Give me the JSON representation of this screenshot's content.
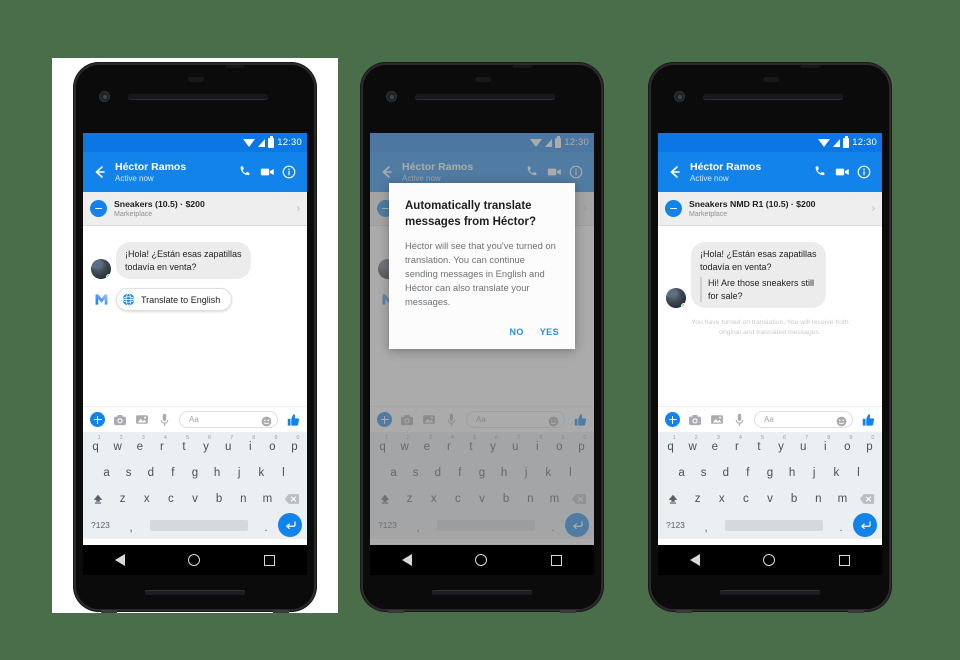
{
  "background_color": "#4a6d4a",
  "accent_color": "#1183ea",
  "status_bar": {
    "time": "12:30",
    "icons": [
      "wifi-icon",
      "signal-icon",
      "battery-icon"
    ]
  },
  "chat_header": {
    "back_icon": "arrow-left-icon",
    "contact_name": "Héctor Ramos",
    "presence": "Active now",
    "call_icon": "phone-icon",
    "video_icon": "video-camera-icon",
    "info_icon": "info-circle-icon"
  },
  "marketplace_row": {
    "icon": "marketplace-icon",
    "title_phone1": "Sneakers (10.5) · $200",
    "title_phone2": "Sneakers NMD R1 (10.5) · $200",
    "title_phone3": "Sneakers NMD R1 (10.5) · $200",
    "subtitle": "Marketplace",
    "chevron": "chevron-right-icon"
  },
  "conversation": {
    "incoming_original_line1": "¡Hola! ¿Están esas zapatillas",
    "incoming_original_line2": "todavía en venta?",
    "incoming_translated_line1": "Hi! Are those sneakers still",
    "incoming_translated_line2": "for sale?",
    "avatar": "contact-avatar",
    "online_indicator": "online-status-dot"
  },
  "translate_prompt": {
    "messenger_logo": "messenger-m-logo",
    "globe_icon": "globe-icon",
    "button_label": "Translate to English"
  },
  "translation_notice": {
    "line1": "You have turned on translation. You will receive both",
    "line2": "original and translated messages."
  },
  "dialog": {
    "title_line1": "Automatically translate",
    "title_line2": "messages from Héctor?",
    "body": "Héctor will see that you've turned on translation. You can continue sending messages in English and Héctor can also translate your messages.",
    "no_label": "NO",
    "yes_label": "YES"
  },
  "input_bar": {
    "plus_icon": "plus-circle-icon",
    "camera_icon": "camera-icon",
    "gallery_icon": "photo-gallery-icon",
    "mic_icon": "microphone-icon",
    "text_placeholder": "Aa",
    "emoji_icon": "emoji-smiley-icon",
    "thumb_icon": "thumbs-up-icon"
  },
  "keyboard": {
    "row1": [
      {
        "key": "q",
        "num": "1"
      },
      {
        "key": "w",
        "num": "2"
      },
      {
        "key": "e",
        "num": "3"
      },
      {
        "key": "r",
        "num": "4"
      },
      {
        "key": "t",
        "num": "5"
      },
      {
        "key": "y",
        "num": "6"
      },
      {
        "key": "u",
        "num": "7"
      },
      {
        "key": "i",
        "num": "8"
      },
      {
        "key": "o",
        "num": "9"
      },
      {
        "key": "p",
        "num": "0"
      }
    ],
    "row2": [
      "a",
      "s",
      "d",
      "f",
      "g",
      "h",
      "j",
      "k",
      "l"
    ],
    "row3": [
      "z",
      "x",
      "c",
      "v",
      "b",
      "n",
      "m"
    ],
    "shift_icon": "shift-key-icon",
    "delete_icon": "backspace-key-icon",
    "symbols_label": "?123",
    "comma": ",",
    "period": ".",
    "enter_icon": "enter-key-icon"
  },
  "nav_bar": {
    "back": "back-triangle-icon",
    "home": "home-circle-icon",
    "recents": "recents-square-icon"
  }
}
